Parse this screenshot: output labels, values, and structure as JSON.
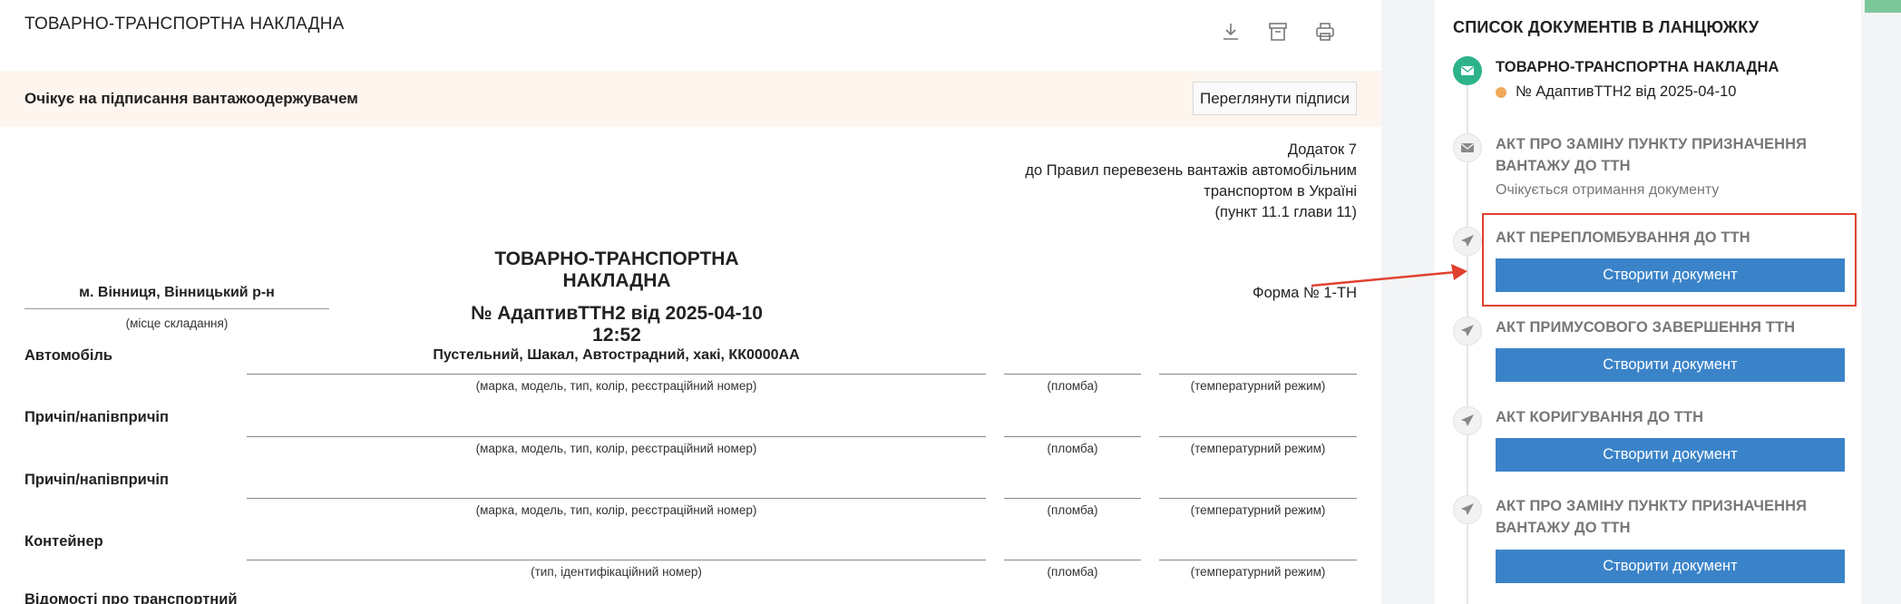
{
  "document": {
    "header_title": "ТОВАРНО-ТРАНСПОРТНА НАКЛАДНА",
    "toolbar_icons": [
      "download-icon",
      "archive-icon",
      "print-icon"
    ],
    "status_text": "Очікує на підписання вантажоодержувачем",
    "view_signatures_label": "Переглянути підписи",
    "annex": {
      "line1": "Додаток 7",
      "line2": "до Правил перевезень вантажів автомобільним",
      "line3": "транспортом в Україні",
      "line4": "(пункт 11.1 глави 11)"
    },
    "title": "ТОВАРНО-ТРАНСПОРТНА НАКЛАДНА",
    "number_line": "№ АдаптивТТН2 від 2025-04-10 12:52",
    "place": "м. Вінниця, Вінницький р-н",
    "place_caption": "(місце складання)",
    "form_number": "Форма № 1-ТН",
    "rows": [
      {
        "label": "Автомобіль",
        "value": "Пустельний, Шакал, Автострадний, хакі, КК0000АА",
        "caption": "(марка, модель, тип, колір, реєстраційний номер)",
        "seal_caption": "(пломба)",
        "temp_caption": "(температурний режим)"
      },
      {
        "label": "Причіп/напівпричіп",
        "value": "",
        "caption": "(марка, модель, тип, колір, реєстраційний номер)",
        "seal_caption": "(пломба)",
        "temp_caption": "(температурний режим)"
      },
      {
        "label": "Причіп/напівпричіп",
        "value": "",
        "caption": "(марка, модель, тип, колір, реєстраційний номер)",
        "seal_caption": "(пломба)",
        "temp_caption": "(температурний режим)"
      },
      {
        "label": "Контейнер",
        "value": "",
        "caption": "(тип, ідентифікаційний номер)",
        "seal_caption": "(пломба)",
        "temp_caption": "(температурний режим)"
      }
    ],
    "cut_label": "Відомості про транспортний"
  },
  "sidebar": {
    "title": "СПИСОК ДОКУМЕНТІВ В ЛАНЦЮЖКУ",
    "items": [
      {
        "title": "ТОВАРНО-ТРАНСПОРТНА НАКЛАДНА",
        "subtitle": "№ АдаптивТТН2 від 2025-04-10",
        "icon": "envelope-icon",
        "state": "active"
      },
      {
        "title": "АКТ ПРО ЗАМІНУ ПУНКТУ ПРИЗНАЧЕННЯ ВАНТАЖУ ДО ТТН",
        "wait_text": "Очікується отримання документу",
        "icon": "envelope-icon",
        "state": "pending"
      },
      {
        "title": "АКТ ПЕРЕПЛОМБУВАННЯ ДО ТТН",
        "button": "Створити документ",
        "icon": "send-icon",
        "state": "pending",
        "highlighted": true
      },
      {
        "title": "АКТ ПРИМУСОВОГО ЗАВЕРШЕННЯ ТТН",
        "button": "Створити документ",
        "icon": "send-icon",
        "state": "pending"
      },
      {
        "title": "АКТ КОРИГУВАННЯ ДО ТТН",
        "button": "Створити документ",
        "icon": "send-icon",
        "state": "pending"
      },
      {
        "title": "АКТ ПРО ЗАМІНУ ПУНКТУ ПРИЗНАЧЕННЯ ВАНТАЖУ ДО ТТН",
        "button": "Створити документ",
        "icon": "send-icon",
        "state": "pending"
      }
    ]
  },
  "colors": {
    "accent_button": "#3a83c9",
    "active_node": "#2db38a",
    "status_dot": "#f0a95b",
    "highlight": "#e0412f",
    "status_bar_bg": "#fdf5ee"
  }
}
